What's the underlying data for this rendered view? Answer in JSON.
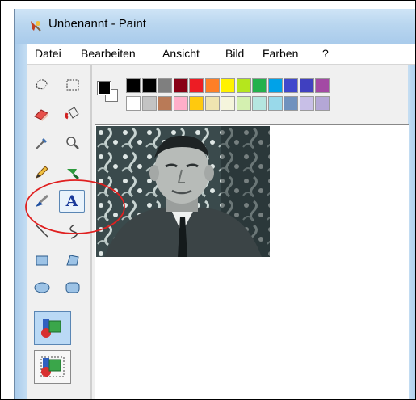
{
  "window": {
    "title": "Unbenannt - Paint"
  },
  "menu": [
    "Datei",
    "Bearbeiten",
    "Ansicht",
    "Bild",
    "Farben",
    "?"
  ],
  "toolbox": {
    "tools": [
      {
        "name": "free-select-icon"
      },
      {
        "name": "rect-select-icon"
      },
      {
        "name": "eraser-icon"
      },
      {
        "name": "fill-bucket-icon"
      },
      {
        "name": "color-picker-icon"
      },
      {
        "name": "magnifier-icon"
      },
      {
        "name": "pencil-icon"
      },
      {
        "name": "airbrush-icon"
      },
      {
        "name": "brush-icon"
      },
      {
        "name": "text-tool-icon",
        "glyph": "A",
        "selected": true
      },
      {
        "name": "line-icon"
      },
      {
        "name": "curve-icon"
      },
      {
        "name": "rectangle-icon"
      },
      {
        "name": "polygon-icon"
      },
      {
        "name": "ellipse-icon"
      },
      {
        "name": "rounded-rect-icon"
      }
    ],
    "options": [
      {
        "name": "opaque-background-option",
        "selected": true
      },
      {
        "name": "transparent-background-option",
        "selected": false
      }
    ]
  },
  "colors": {
    "foreground": "#000000",
    "background": "#ffffff",
    "palette_row1": [
      "#000000",
      "#7f7f7f",
      "#880015",
      "#ed1c24",
      "#ff7f27",
      "#fff200",
      "#b5e61d",
      "#22b14c",
      "#00a2e8",
      "#3f48cc",
      "#4040c0",
      "#a349a4"
    ],
    "palette_row1_lead": "#000000",
    "palette_row2_lead": "#ffffff",
    "palette_row2": [
      "#c3c3c3",
      "#b97a57",
      "#ffaec9",
      "#ffc90e",
      "#efe4b0",
      "#f5f5dc",
      "#d4f0b0",
      "#b5e6e0",
      "#99d9ea",
      "#7092be",
      "#c8bfe7",
      "#b4a7d6"
    ],
    "annotation_color": "#e02020",
    "chrome_blue": "#b9d6ef"
  }
}
